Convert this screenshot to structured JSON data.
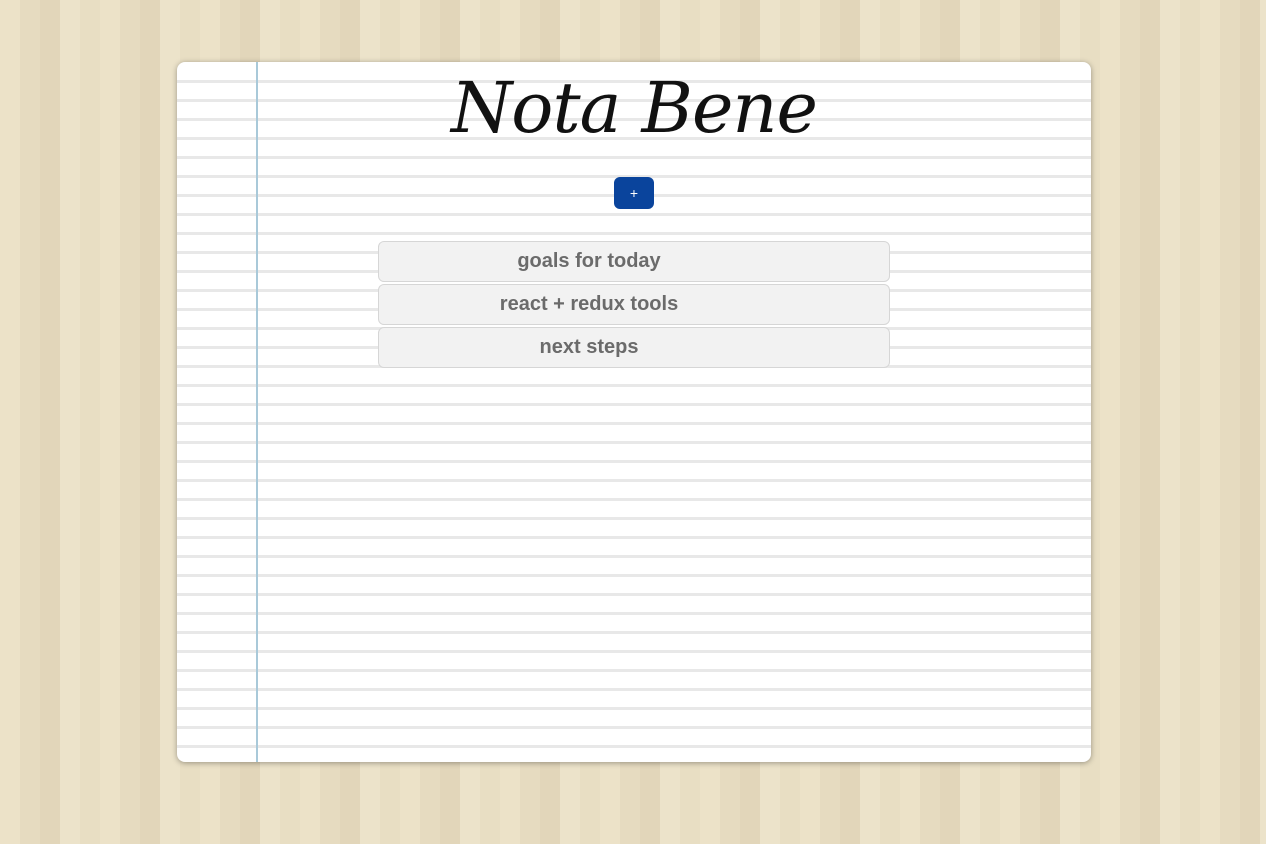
{
  "app": {
    "title": "Nota Bene"
  },
  "toolbar": {
    "add_label": "+"
  },
  "notes": [
    {
      "title": "goals for today"
    },
    {
      "title": "react + redux tools"
    },
    {
      "title": "next steps"
    }
  ],
  "colors": {
    "accent": "#0a449c",
    "margin_line": "#a9c9d9",
    "note_text": "#6b6b6b",
    "note_bg": "#f2f2f2"
  }
}
